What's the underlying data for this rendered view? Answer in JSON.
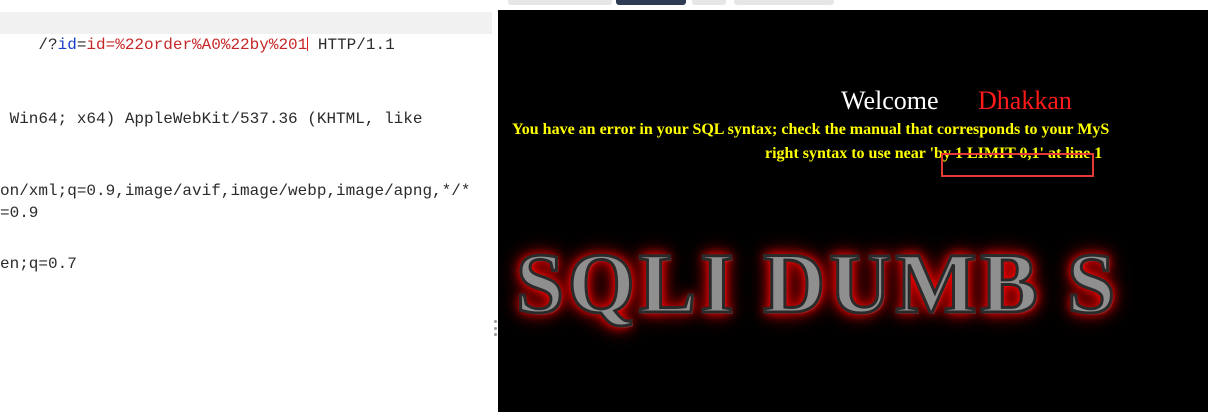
{
  "editor": {
    "lines": [
      {
        "segments": [
          {
            "text": "/?",
            "cls": ""
          },
          {
            "text": "id",
            "cls": "tok-blue"
          },
          {
            "text": "=",
            "cls": ""
          },
          {
            "text": "id=%22order%A0%22by%201",
            "cls": "tok-red"
          },
          {
            "text": " HTTP/1.1",
            "cls": ""
          }
        ]
      },
      {
        "text": " Win64; x64) AppleWebKit/537.36 (KHTML, like"
      },
      {
        "text": "on/xml;q=0.9,image/avif,image/webp,image/apng,*/*"
      },
      {
        "text": "=0.9"
      },
      {
        "text": "en;q=0.7"
      }
    ]
  },
  "response": {
    "welcome_label": "Welcome",
    "welcome_name": "Dhakkan",
    "error_line1": "You have an error in your SQL syntax; check the manual that corresponds to your MyS",
    "error_line2": "right syntax to use near 'by 1 LIMIT 0,1' at line 1",
    "banner_text": "SQLI DUMB S"
  },
  "colors": {
    "error_text": "#ffff00",
    "name_text": "#ff1a1a",
    "highlight_box": "#e53935",
    "param_value": "#c62828",
    "param_name": "#1a3fc7"
  }
}
